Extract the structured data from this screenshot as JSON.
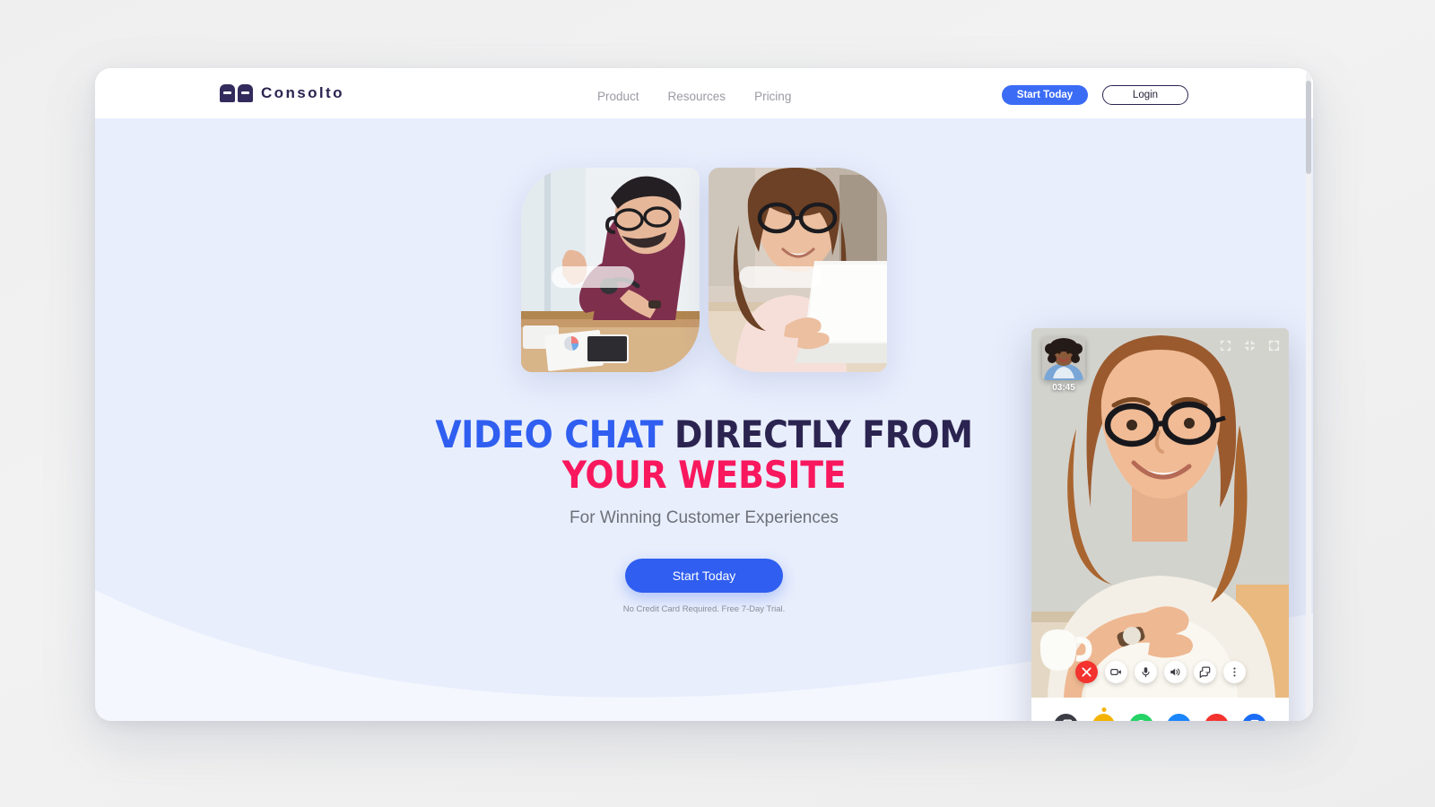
{
  "brand": {
    "name": "Consolto",
    "logo_icon": "consolto-chips-logo",
    "navy": "#2b2450"
  },
  "header": {
    "nav": [
      {
        "label": "Product",
        "name": "nav-product"
      },
      {
        "label": "Resources",
        "name": "nav-resources"
      },
      {
        "label": "Pricing",
        "name": "nav-pricing"
      }
    ],
    "start_today_label": "Start Today",
    "login_label": "Login"
  },
  "hero": {
    "headline_line1_blue": "VIDEO CHAT",
    "headline_line1_dark": " DIRECTLY FROM",
    "headline_line2_pink": "YOUR WEBSITE",
    "subhead": "For Winning Customer Experiences",
    "cta_label": "Start Today",
    "fineprint": "No Credit Card Required. Free 7-Day Trial.",
    "photo_left_alt": "man-waving-at-laptop-photo",
    "photo_right_alt": "woman-smiling-at-laptop-photo",
    "background_color": "#e8eefc",
    "accent_blue": "#2f5ef0",
    "accent_pink": "#f9185e"
  },
  "video_widget": {
    "call_timer": "03:45",
    "self_view_alt": "self-view-thumbnail",
    "remote_view_alt": "remote-participant-video",
    "stage_tools": [
      {
        "name": "collapse-icon"
      },
      {
        "name": "minimize-icon"
      },
      {
        "name": "fullscreen-icon"
      }
    ],
    "controls": [
      {
        "name": "end-call-button",
        "icon": "close-icon",
        "color": "#f4322e"
      },
      {
        "name": "camera-toggle-button",
        "icon": "camera-icon",
        "color": "#ffffff"
      },
      {
        "name": "microphone-toggle-button",
        "icon": "microphone-icon",
        "color": "#ffffff"
      },
      {
        "name": "speaker-toggle-button",
        "icon": "speaker-icon",
        "color": "#ffffff"
      },
      {
        "name": "chat-toggle-button",
        "icon": "chat-bubbles-icon",
        "color": "#ffffff"
      },
      {
        "name": "more-options-button",
        "icon": "three-dots-vertical-icon",
        "color": "#ffffff"
      }
    ],
    "channels": [
      {
        "name": "channel-chat",
        "icon": "chat-bubbles-icon",
        "color": "#3c3c44"
      },
      {
        "name": "channel-video-call",
        "icon": "camera-icon",
        "color": "#f5b301"
      },
      {
        "name": "channel-whatsapp",
        "icon": "whatsapp-icon",
        "color": "#25d366"
      },
      {
        "name": "channel-messenger",
        "icon": "messenger-icon",
        "color": "#1b86fb"
      },
      {
        "name": "channel-phone",
        "icon": "phone-icon",
        "color": "#f4322e"
      },
      {
        "name": "channel-form",
        "icon": "form-icon",
        "color": "#1b6cf6"
      }
    ]
  },
  "scrollbar": {
    "name": "page-scrollbar"
  }
}
